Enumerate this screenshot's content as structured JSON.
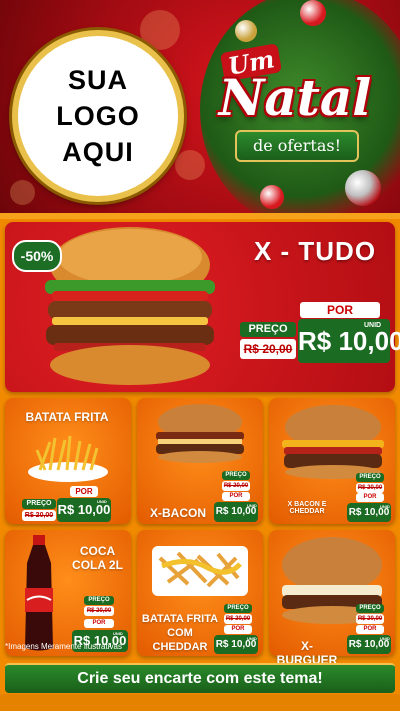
{
  "header": {
    "logo_lines": [
      "SUA",
      "LOGO",
      "AQUI"
    ],
    "title_um": "Um",
    "title_natal": "Natal",
    "title_sub": "de ofertas!"
  },
  "hero": {
    "name": "X - TUDO",
    "discount": "-50%",
    "por": "POR",
    "preco": "PREÇO",
    "old_price": "R$ 20,00",
    "new_price": "R$ 10,00",
    "unid": "UNID"
  },
  "products": [
    {
      "name": "BATATA FRITA",
      "old_price": "R$ 20,00",
      "new_price": "R$ 10,00"
    },
    {
      "name": "X-BACON",
      "old_price": "R$ 20,00",
      "new_price": "R$ 10,00"
    },
    {
      "name": "X BACON E CHEDDAR",
      "old_price": "R$ 20,00",
      "new_price": "R$ 10,00"
    },
    {
      "name": "COCA COLA 2L",
      "old_price": "R$ 20,00",
      "new_price": "R$ 10,00"
    },
    {
      "name": "BATATA FRITA COM CHEDDAR",
      "old_price": "R$ 20,00",
      "new_price": "R$ 10,00"
    },
    {
      "name": "X-BURGUER",
      "old_price": "R$ 20,00",
      "new_price": "R$ 10,00"
    }
  ],
  "labels": {
    "por": "POR",
    "preco": "PREÇO",
    "unid": "UNID"
  },
  "footer": {
    "note": "*Imagens Meramente Ilustrativas",
    "cta": "Crie seu encarte com este tema!"
  },
  "colors": {
    "red": "#d6141c",
    "green": "#1c6b22",
    "orange": "#f28a00",
    "gold": "#e9c14a"
  }
}
